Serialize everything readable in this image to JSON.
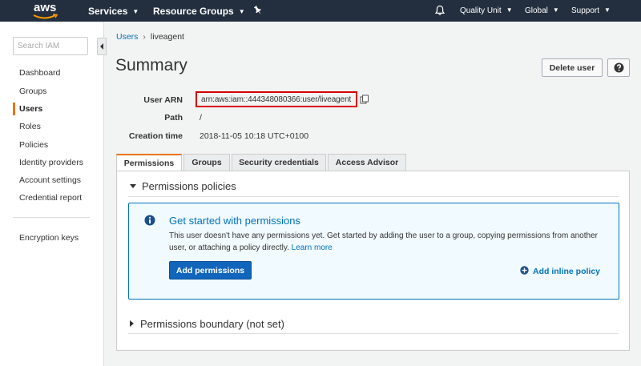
{
  "topnav": {
    "logo_text": "aws",
    "services_label": "Services",
    "resource_groups_label": "Resource Groups",
    "account_label": "Quality Unit",
    "region_label": "Global",
    "support_label": "Support",
    "background_color": "#232f3e"
  },
  "sidebar": {
    "search_placeholder": "Search IAM",
    "items": [
      {
        "label": "Dashboard"
      },
      {
        "label": "Groups"
      },
      {
        "label": "Users"
      },
      {
        "label": "Roles"
      },
      {
        "label": "Policies"
      },
      {
        "label": "Identity providers"
      },
      {
        "label": "Account settings"
      },
      {
        "label": "Credential report"
      }
    ],
    "extra_item": "Encryption keys",
    "active_item": "Users",
    "accent_color": "#ec7211"
  },
  "breadcrumb": {
    "parent": "Users",
    "separator": "›",
    "current": "liveagent"
  },
  "page": {
    "title": "Summary",
    "delete_label": "Delete user"
  },
  "details": {
    "arn_label": "User ARN",
    "arn_value": "arn:aws:iam::444348080366:user/liveagent",
    "path_label": "Path",
    "path_value": "/",
    "creation_label": "Creation time",
    "creation_value": "2018-11-05 10:18 UTC+0100",
    "highlight_color": "#d60000"
  },
  "tabs": [
    {
      "label": "Permissions",
      "active": true
    },
    {
      "label": "Groups"
    },
    {
      "label": "Security credentials"
    },
    {
      "label": "Access Advisor"
    }
  ],
  "permissions": {
    "policies_heading": "Permissions policies",
    "info_title": "Get started with permissions",
    "info_body": "This user doesn't have any permissions yet. Get started by adding the user to a group, copying permissions from another user, or attaching a policy directly.",
    "learn_more": "Learn more",
    "add_permissions_label": "Add permissions",
    "add_inline_label": "Add inline policy",
    "boundary_heading": "Permissions boundary (not set)",
    "link_color": "#0073bb"
  }
}
